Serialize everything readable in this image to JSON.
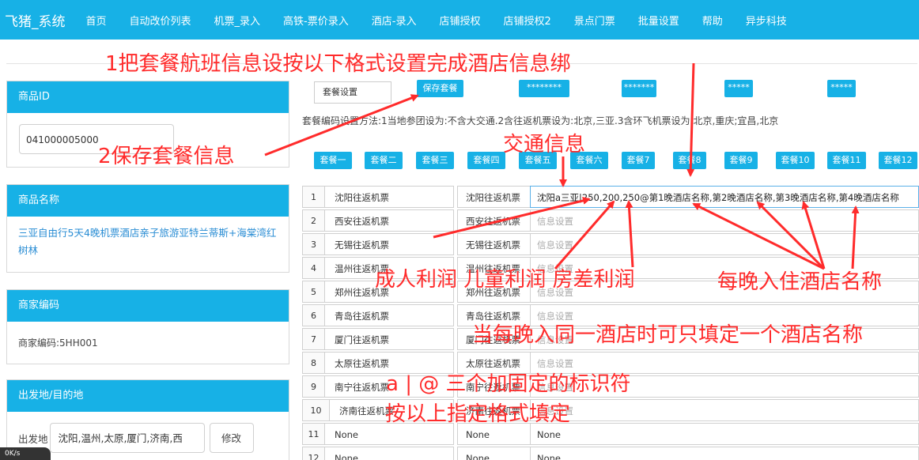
{
  "brand": "飞猪_系统",
  "nav": [
    "首页",
    "自动改价列表",
    "机票_录入",
    "高铁-票价录入",
    "酒店-录入",
    "店铺授权",
    "店铺授权2",
    "景点门票",
    "批量设置",
    "帮助",
    "异步科技"
  ],
  "panels": {
    "product_id": {
      "title": "商品ID",
      "value": "041000005000"
    },
    "product_name": {
      "title": "商品名称",
      "value": "三亚自由行5天4晚机票酒店亲子旅游亚特兰蒂斯+海棠湾红树林"
    },
    "merchant_code": {
      "title": "商家编码",
      "value": "商家编码:5HH001"
    },
    "departure": {
      "title": "出发地/目的地",
      "label": "出发地",
      "value": "沈阳,温州,太原,厦门,济南,西",
      "button": "修改"
    }
  },
  "package": {
    "setting_placeholder": "套餐设置",
    "save_button": "保存套餐",
    "masked_buttons": [
      "********",
      "*******",
      "*****",
      "*****"
    ],
    "hint": "套餐编码设置方法:1当地参团设为:不含大交通.2含往返机票设为:北京,三亚.3含环飞机票设为:北京,重庆;宜昌,北京",
    "tabs": [
      "套餐一",
      "套餐二",
      "套餐三",
      "套餐四",
      "套餐五",
      "套餐六",
      "套餐7",
      "套餐8",
      "套餐9",
      "套餐10",
      "套餐11",
      "套餐12"
    ]
  },
  "rows": [
    {
      "num": "1",
      "a": "沈阳往返机票",
      "b": "沈阳往返机票",
      "c": "沈阳a三亚|250,200,250@第1晚酒店名称,第2晚酒店名称,第3晚酒店名称,第4晚酒店名称"
    },
    {
      "num": "2",
      "a": "西安往返机票",
      "b": "西安往返机票",
      "c": "信息设置"
    },
    {
      "num": "3",
      "a": "无锡往返机票",
      "b": "无锡往返机票",
      "c": "信息设置"
    },
    {
      "num": "4",
      "a": "温州往返机票",
      "b": "温州往返机票",
      "c": "信息设置"
    },
    {
      "num": "5",
      "a": "郑州往返机票",
      "b": "郑州往返机票",
      "c": "信息设置"
    },
    {
      "num": "6",
      "a": "青岛往返机票",
      "b": "青岛往返机票",
      "c": "信息设置"
    },
    {
      "num": "7",
      "a": "厦门往返机票",
      "b": "厦门往返机票",
      "c": "信息设置"
    },
    {
      "num": "8",
      "a": "太原往返机票",
      "b": "太原往返机票",
      "c": "信息设置"
    },
    {
      "num": "9",
      "a": "南宁往返机票",
      "b": "南宁往返机票",
      "c": "信息设置"
    },
    {
      "num": "10",
      "a": "济南往返机票",
      "b": "济南往返机票",
      "c": "信息设置"
    },
    {
      "num": "11",
      "a": "None",
      "b": "None",
      "c": "None"
    },
    {
      "num": "12",
      "a": "None",
      "b": "None",
      "c": "None"
    }
  ],
  "annotations": {
    "a1": "1把套餐航班信息设按以下格式设置完成酒店信息绑",
    "a2": "2保存套餐信息",
    "a3": "交通信息",
    "a4": "成人利润 儿童利润  房差利润",
    "a5": "每晚入住酒店名称",
    "a6": "当每晚入同一酒店时可只填定一个酒店名称",
    "a7": "a | @ 三个加固定的标识符",
    "a8": "按以上指定格式填定"
  },
  "status": {
    "speed": "0K/s"
  },
  "colors": {
    "primary": "#17b1e6",
    "annotation": "#ff2b2b"
  }
}
